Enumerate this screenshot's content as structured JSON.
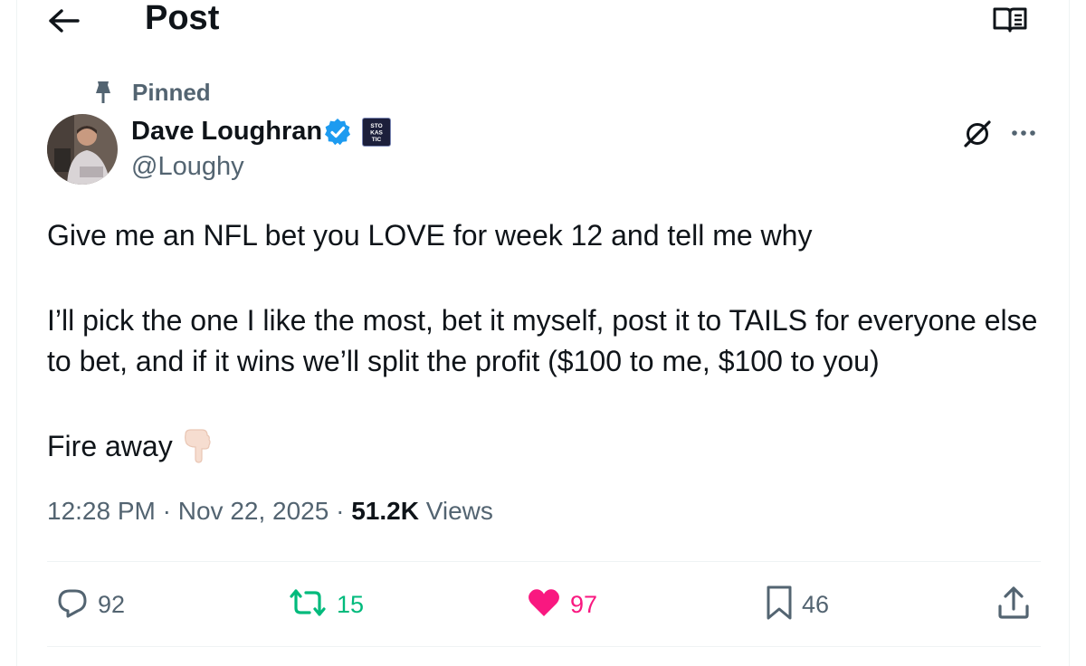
{
  "header": {
    "title": "Post",
    "back_icon": "arrow-left-icon",
    "reader_icon": "reader-mode-icon"
  },
  "pinned": {
    "label": "Pinned",
    "icon": "pin-icon"
  },
  "author": {
    "display_name": "Dave Loughran",
    "handle": "@Loughy",
    "verified": true,
    "affiliate_badge_text": "STOKASTIC",
    "verified_color": "#1d9bf0"
  },
  "tweet": {
    "paragraphs": [
      "Give me an NFL bet you LOVE for week 12 and tell me why",
      "I’ll pick the one I like the most, bet it myself, post it to TAILS for everyone else to bet, and if it wins we’ll split the profit ($100 to me, $100 to you)",
      "Fire away"
    ],
    "emoji_icon": "backhand-index-pointing-down-icon"
  },
  "meta": {
    "time": "12:28 PM",
    "separator": "·",
    "date": "Nov 22, 2025",
    "views_count": "51.2K",
    "views_label": "Views"
  },
  "actions": {
    "replies": "92",
    "reposts": "15",
    "likes": "97",
    "bookmarks": "46"
  },
  "colors": {
    "text": "#0f1419",
    "secondary": "#536471",
    "repost": "#00ba7c",
    "like": "#f91880",
    "divider": "#eff3f4"
  }
}
